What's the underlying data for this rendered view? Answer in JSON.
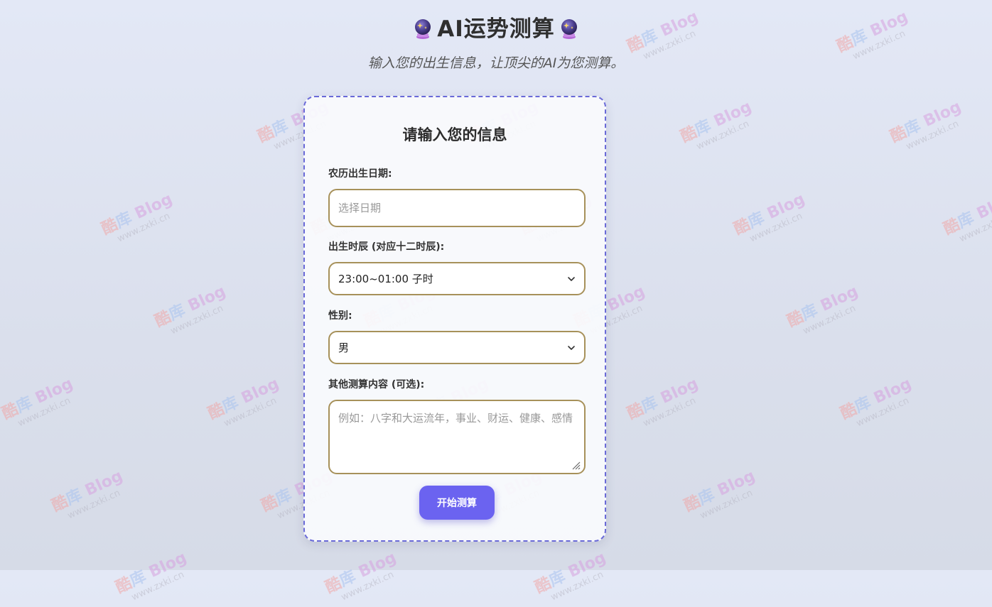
{
  "header": {
    "title": "AI运势测算",
    "subtitle": "输入您的出生信息，让顶尖的AI为您测算。",
    "icon": "crystal-ball-icon"
  },
  "watermark": {
    "brand_part1": "酷",
    "brand_part2": "库",
    "brand_part3": "Blog",
    "url": "www.zxki.cn"
  },
  "form": {
    "title": "请输入您的信息",
    "date": {
      "label": "农历出生日期:",
      "placeholder": "选择日期",
      "value": ""
    },
    "hour": {
      "label": "出生时辰 (对应十二时辰):",
      "selected": "23:00~01:00 子时"
    },
    "gender": {
      "label": "性别:",
      "selected": "男"
    },
    "extra": {
      "label": "其他测算内容 (可选):",
      "placeholder": "例如：八字和大运流年，事业、财运、健康、感情",
      "value": ""
    },
    "submit_label": "开始测算"
  },
  "colors": {
    "accent": "#6b63f0",
    "field_border": "#a7915a",
    "card_border": "#6a6ad8"
  }
}
